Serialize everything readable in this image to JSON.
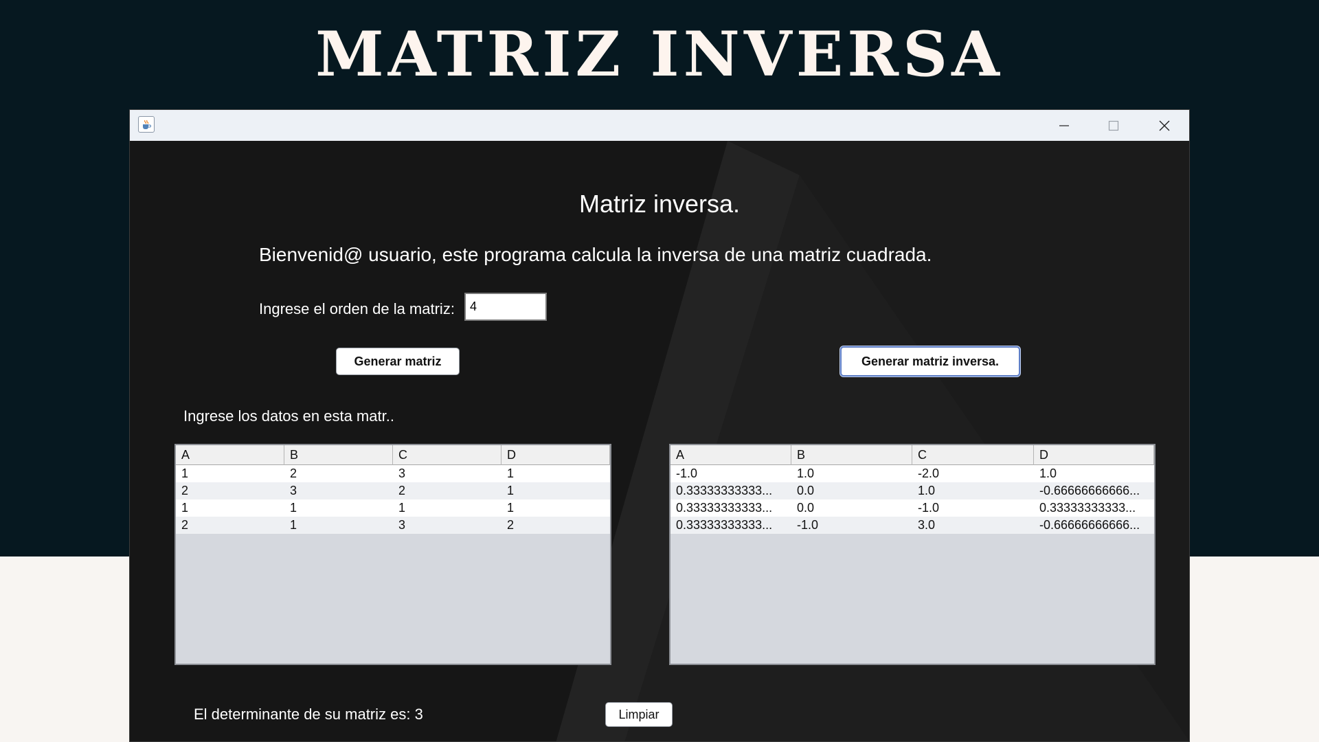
{
  "banner": {
    "title": "MATRIZ INVERSA"
  },
  "window": {
    "icon": "java-cup-icon",
    "controls": [
      "minimize-icon",
      "maximize-icon",
      "close-icon"
    ]
  },
  "main": {
    "heading": "Matriz inversa.",
    "welcome": "Bienvenid@ usuario, este programa calcula la inversa de una matriz cuadrada.",
    "order_label": "Ingrese el orden de la matriz:",
    "order_value": "4",
    "generate_button": "Generar matriz",
    "inverse_button": "Generar matriz inversa.",
    "data_label": "Ingrese los datos en esta matr..",
    "determinant_label": "El determinante de su matriz es: 3",
    "clear_button": "Limpiar"
  },
  "input_table": {
    "columns": [
      "A",
      "B",
      "C",
      "D"
    ],
    "rows": [
      [
        "1",
        "2",
        "3",
        "1"
      ],
      [
        "2",
        "3",
        "2",
        "1"
      ],
      [
        "1",
        "1",
        "1",
        "1"
      ],
      [
        "2",
        "1",
        "3",
        "2"
      ]
    ]
  },
  "inverse_table": {
    "columns": [
      "A",
      "B",
      "C",
      "D"
    ],
    "rows": [
      [
        "-1.0",
        "1.0",
        "-2.0",
        "1.0"
      ],
      [
        "0.33333333333...",
        "0.0",
        "1.0",
        "-0.66666666666..."
      ],
      [
        "0.33333333333...",
        "0.0",
        "-1.0",
        "0.33333333333..."
      ],
      [
        "0.33333333333...",
        "-1.0",
        "3.0",
        "-0.66666666666..."
      ]
    ]
  },
  "colors": {
    "banner_bg": "#061820",
    "page_bg": "#f8f5f2",
    "window_bg": "#1b1b1b",
    "titlebar_bg": "#edf1f6",
    "accent_border": "#5c7cc4"
  }
}
